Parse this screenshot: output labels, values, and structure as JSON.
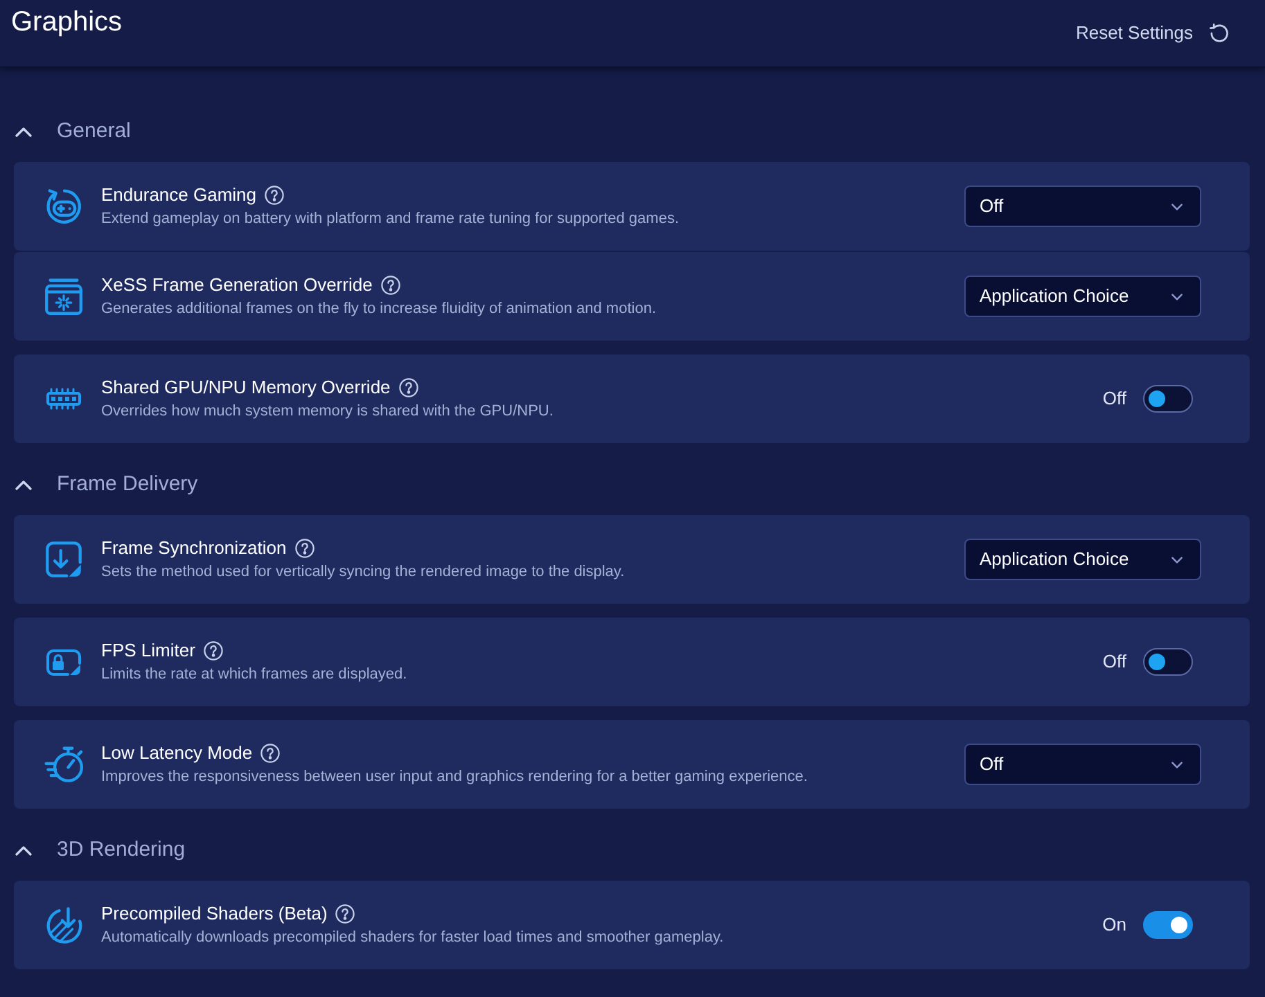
{
  "header": {
    "title": "Graphics",
    "reset_button": "Reset Settings"
  },
  "sections": [
    {
      "title": "General",
      "expanded": true,
      "groups": [
        {
          "settings": [
            {
              "title": "Endurance Gaming",
              "description": "Extend gameplay on battery with platform and frame rate tuning for supported games.",
              "control": {
                "kind": "dropdown",
                "value": "Off"
              }
            },
            {
              "title": "XeSS Frame Generation Override",
              "description": "Generates additional frames on the fly to increase fluidity of animation and motion.",
              "control": {
                "kind": "dropdown",
                "value": "Application Choice"
              }
            }
          ]
        },
        {
          "settings": [
            {
              "title": "Shared GPU/NPU Memory Override",
              "description": "Overrides how much system memory is shared with the GPU/NPU.",
              "control": {
                "kind": "toggle",
                "on": false,
                "label": "Off"
              }
            }
          ]
        }
      ]
    },
    {
      "title": "Frame Delivery",
      "expanded": true,
      "groups": [
        {
          "settings": [
            {
              "title": "Frame Synchronization",
              "description": "Sets the method used for vertically syncing the rendered image to the display.",
              "control": {
                "kind": "dropdown",
                "value": "Application Choice"
              }
            }
          ]
        },
        {
          "settings": [
            {
              "title": "FPS Limiter",
              "description": "Limits the rate at which frames are displayed.",
              "control": {
                "kind": "toggle",
                "on": false,
                "label": "Off"
              }
            }
          ]
        },
        {
          "settings": [
            {
              "title": "Low Latency Mode",
              "description": "Improves the responsiveness between user input and graphics rendering for a better gaming experience.",
              "control": {
                "kind": "dropdown",
                "value": "Off"
              }
            }
          ]
        }
      ]
    },
    {
      "title": "3D Rendering",
      "expanded": true,
      "groups": [
        {
          "settings": [
            {
              "title": "Precompiled Shaders (Beta)",
              "description": "Automatically downloads precompiled shaders for faster load times and smoother gameplay.",
              "control": {
                "kind": "toggle",
                "on": true,
                "label": "On"
              }
            }
          ]
        }
      ]
    }
  ]
}
